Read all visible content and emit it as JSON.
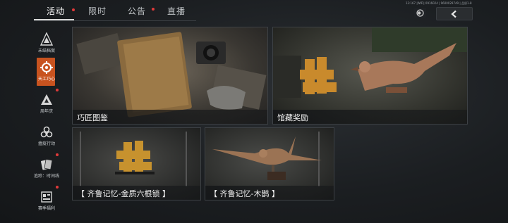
{
  "header": {
    "tabs": [
      {
        "label": "活动",
        "active": true,
        "badge": true
      },
      {
        "label": "限时",
        "active": false,
        "badge": false
      },
      {
        "label": "公告",
        "active": false,
        "badge": true
      },
      {
        "label": "直播",
        "active": false,
        "badge": false
      }
    ],
    "status_text": "13:167 |WIFI| 0916024 | 9600029749 | 品质1-8",
    "icons": {
      "settings": "circle-toggle-icon",
      "back": "chevron-left-icon"
    }
  },
  "sidebar": {
    "items": [
      {
        "label": "未结档案",
        "icon": "archive-triangle-icon",
        "active": false,
        "badge": false
      },
      {
        "label": "天工巧心",
        "icon": "craft-gear-icon",
        "active": true,
        "badge": false
      },
      {
        "label": "周年庆",
        "icon": "anniversary-triangle-icon",
        "active": false,
        "badge": true
      },
      {
        "label": "瘟疫行动",
        "icon": "biohazard-icon",
        "active": false,
        "badge": false
      },
      {
        "label": "追踪：时间线",
        "icon": "cards-icon",
        "active": false,
        "badge": true
      },
      {
        "label": "赛季福利",
        "icon": "season-gift-icon",
        "active": false,
        "badge": true
      }
    ],
    "accent_color": "#c8531f"
  },
  "cards": [
    {
      "title": "巧匠图鉴"
    },
    {
      "title": "馆藏奖励"
    },
    {
      "title": "【 齐鲁记忆-金质六根锁 】"
    },
    {
      "title": "【 齐鲁记忆-木鹊 】"
    }
  ]
}
